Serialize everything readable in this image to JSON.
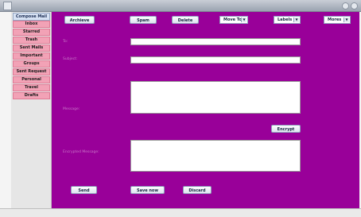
{
  "sidebar": {
    "compose_label": "Compose Mail",
    "folders": [
      "Inbox",
      "Starred",
      "Trash",
      "Sent Mails",
      "Important",
      "Groups",
      "Sent Request",
      "Personal",
      "Travel",
      "Drafts"
    ]
  },
  "toolbar": {
    "archieve_label": "Archieve",
    "spam_label": "Spam",
    "delete_label": "Delete",
    "move_to_label": "Move To",
    "labels_label": "Labels",
    "mores_label": "Mores"
  },
  "form": {
    "to_label": "To:",
    "subject_label": "Subject:",
    "message_label": "Message:",
    "encrypted_label": "Encrypted Message:",
    "encrypt_button": "Encrypt"
  },
  "actions": {
    "send_label": "Send",
    "save_label": "Save now",
    "discard_label": "Discard"
  },
  "colors": {
    "panel_bg": "#990099",
    "folder_bg": "#f2a2b6"
  }
}
